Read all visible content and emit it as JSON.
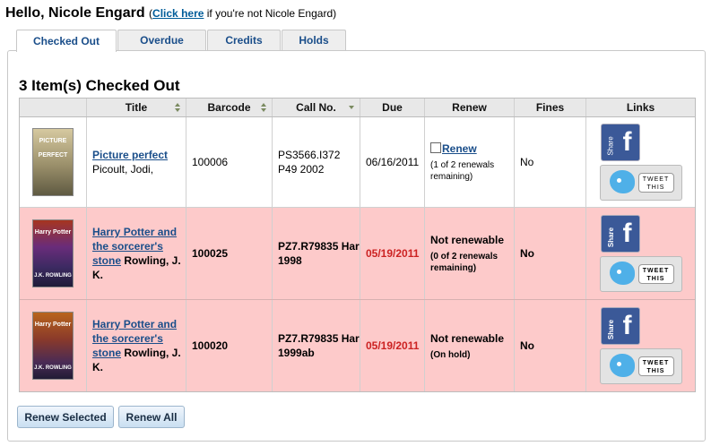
{
  "greeting": {
    "text": "Hello, Nicole Engard",
    "prefix": "(",
    "link": "Click here",
    "suffix": " if you're not Nicole Engard)"
  },
  "tabs": [
    {
      "label": "Checked Out",
      "active": true
    },
    {
      "label": "Overdue",
      "active": false
    },
    {
      "label": "Credits",
      "active": false
    },
    {
      "label": "Holds",
      "active": false
    }
  ],
  "heading": "3 Item(s) Checked Out",
  "columns": [
    "",
    "Title",
    "Barcode",
    "Call No.",
    "Due",
    "Renew",
    "Fines",
    "Links"
  ],
  "items": [
    {
      "cover": {
        "title": "PICTURE PERFECT",
        "author": ""
      },
      "title": "Picture perfect",
      "author": "Picoult, Jodi,",
      "barcode": "100006",
      "call_no": "PS3566.I372 P49 2002",
      "due": "06/16/2011",
      "renew_label": "Renew",
      "renew_note": "(1 of 2 renewals remaining)",
      "fines": "No",
      "overdue": false
    },
    {
      "cover": {
        "title": "Harry Potter",
        "author": "J.K. ROWLING"
      },
      "title": "Harry Potter and the sorcerer's stone",
      "author": "Rowling, J. K.",
      "barcode": "100025",
      "call_no": "PZ7.R79835 Har 1998",
      "due": "05/19/2011",
      "renew_label": "Not renewable",
      "renew_note": "(0 of 2 renewals remaining)",
      "fines": "No",
      "overdue": true
    },
    {
      "cover": {
        "title": "Harry Potter",
        "author": "J.K. ROWLING"
      },
      "title": "Harry Potter and the sorcerer's stone",
      "author": "Rowling, J. K.",
      "barcode": "100020",
      "call_no": "PZ7.R79835 Har 1999ab",
      "due": "05/19/2011",
      "renew_label": "Not renewable",
      "renew_note": "(On hold)",
      "fines": "No",
      "overdue": true
    }
  ],
  "share": {
    "facebook_label": "Share",
    "facebook_letter": "f",
    "tweet_label": "TWEET THIS"
  },
  "buttons": {
    "renew_selected": "Renew Selected",
    "renew_all": "Renew All"
  },
  "colors": {
    "link": "#1a4e8a",
    "overdue_row": "#fdcaca",
    "overdue_due": "#cc2222",
    "facebook": "#3b5998",
    "twitter": "#4fb0e8"
  }
}
